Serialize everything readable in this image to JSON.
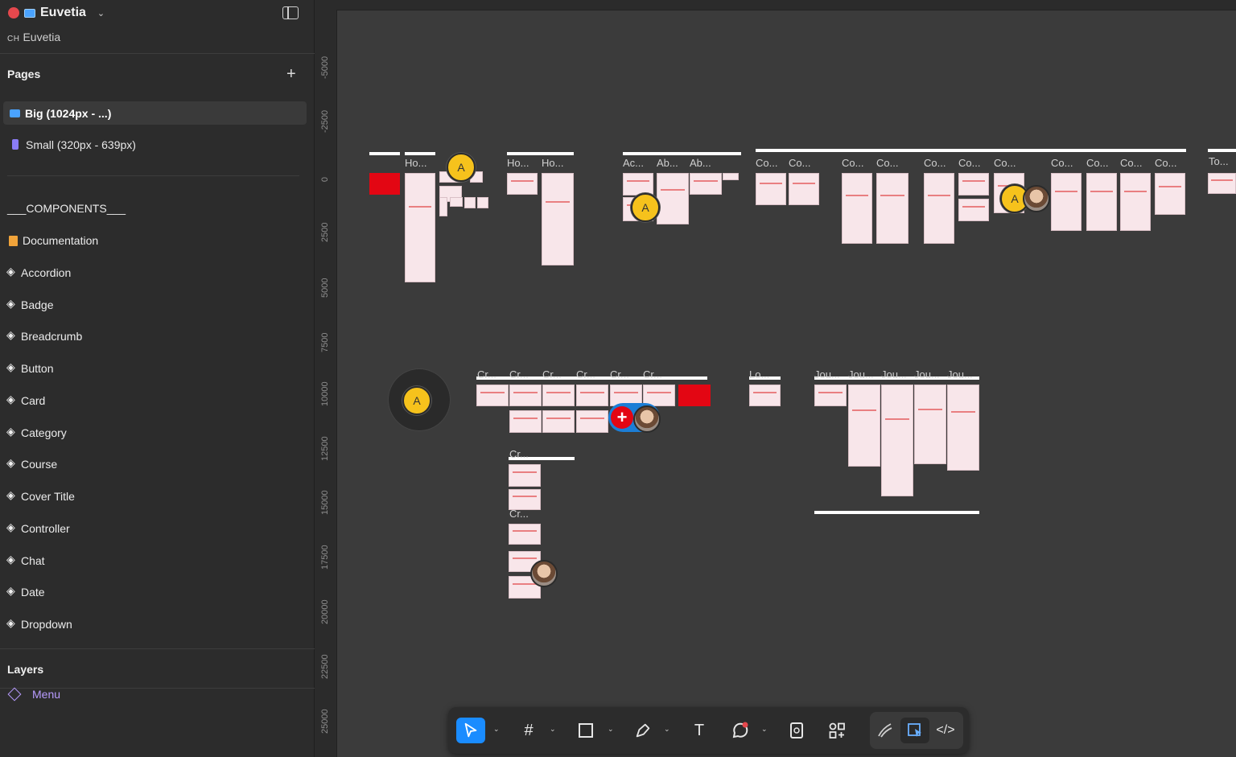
{
  "file": {
    "name": "Euvetia",
    "team_flag": "CH",
    "team_name": "Euvetia"
  },
  "pages": {
    "title": "Pages",
    "items": [
      {
        "label": "Big (1024px - ...)",
        "active": true
      },
      {
        "label": "Small (320px - 639px)",
        "active": false
      }
    ]
  },
  "components": {
    "header": "___COMPONENTS___",
    "items": [
      "Documentation",
      "Accordion",
      "Badge",
      "Breadcrumb",
      "Button",
      "Card",
      "Category",
      "Course",
      "Cover Title",
      "Controller",
      "Chat",
      "Date",
      "Dropdown"
    ]
  },
  "layers": {
    "title": "Layers",
    "items": [
      "Menu"
    ]
  },
  "ruler": {
    "vertical": [
      "-5000",
      "-2500",
      "0",
      "2500",
      "5000",
      "7500",
      "10000",
      "12500",
      "15000",
      "17500",
      "20000",
      "22500",
      "25000"
    ]
  },
  "canvas": {
    "labels": [
      "Ho...",
      "Ho...",
      "Ho...",
      "Ho...",
      "Ac...",
      "Ab...",
      "Ab...",
      "Co...",
      "Co...",
      "Co...",
      "Co...",
      "Co...",
      "Co...",
      "Co...",
      "Co...",
      "Co...",
      "Co...",
      "Co...",
      "To...",
      "Cr...",
      "Cr...",
      "Cr...",
      "Cr...",
      "Cr...",
      "Cr...",
      "Cr...",
      "Cr...",
      "Lo...",
      "Jou...",
      "Jou...",
      "Jou...",
      "Jou...",
      "Jou..."
    ],
    "avatar_initial": "A"
  },
  "colors": {
    "accent": "#1a8cff",
    "brand_red": "#e30613",
    "avatar": "#f6c21c"
  },
  "toolbar": {
    "tools": [
      "move-tool",
      "frame-tool",
      "rectangle-tool",
      "pen-tool",
      "text-tool",
      "comment-tool",
      "resource-tool",
      "actions-tool",
      "draw-mode",
      "design-mode",
      "dev-mode"
    ]
  }
}
